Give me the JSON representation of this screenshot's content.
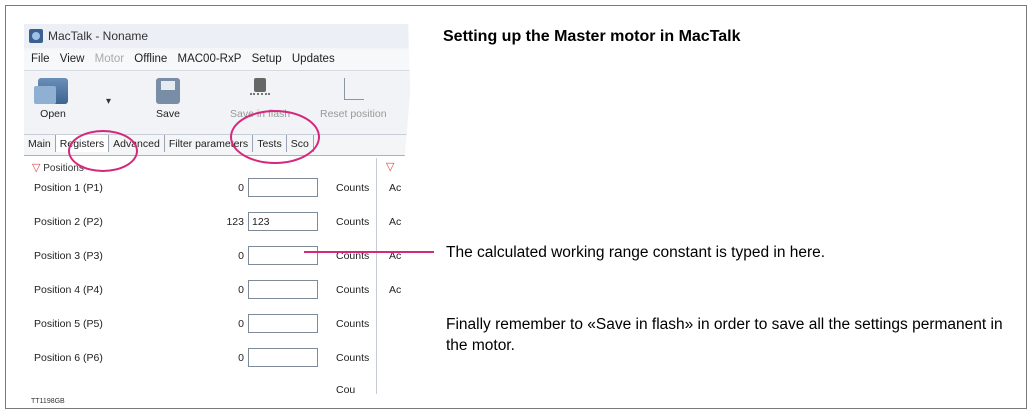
{
  "heading": "Setting up the Master motor in MacTalk",
  "window": {
    "title": "MacTalk - Noname",
    "menu": [
      {
        "label": "File",
        "disabled": false
      },
      {
        "label": "View",
        "disabled": false
      },
      {
        "label": "Motor",
        "disabled": true
      },
      {
        "label": "Offline",
        "disabled": false
      },
      {
        "label": "MAC00-RxP",
        "disabled": false
      },
      {
        "label": "Setup",
        "disabled": false
      },
      {
        "label": "Updates",
        "disabled": false
      }
    ],
    "toolbar": {
      "open": "Open",
      "save": "Save",
      "save_in_flash": "Save in flash",
      "reset_position": "Reset position"
    },
    "tabs": [
      "Main",
      "Registers",
      "Advanced",
      "Filter parameters",
      "Tests",
      "Sco"
    ],
    "group_title": "Positions",
    "rows": [
      {
        "label": "Position 1 (P1)",
        "value": "0",
        "input": "",
        "unit": "Counts",
        "right": "Ac"
      },
      {
        "label": "Position 2 (P2)",
        "value": "123",
        "input": "123",
        "unit": "Counts",
        "right": "Ac"
      },
      {
        "label": "Position 3 (P3)",
        "value": "0",
        "input": "",
        "unit": "Counts",
        "right": "Ac"
      },
      {
        "label": "Position 4 (P4)",
        "value": "0",
        "input": "",
        "unit": "Counts",
        "right": "Ac"
      },
      {
        "label": "Position 5 (P5)",
        "value": "0",
        "input": "",
        "unit": "Counts",
        "right": ""
      },
      {
        "label": "Position 6 (P6)",
        "value": "0",
        "input": "",
        "unit": "Counts",
        "right": ""
      },
      {
        "label": "",
        "value": "",
        "input": "",
        "unit": "Cou",
        "right": ""
      }
    ]
  },
  "callout": "The calculated working range constant is typed in here.",
  "final_note": "Finally remember to «Save in flash» in order to save all the settings permanent in the motor.",
  "figure_code": "TT1198GB",
  "colors": {
    "highlight": "#d4287c",
    "triangle": "#e04040"
  }
}
